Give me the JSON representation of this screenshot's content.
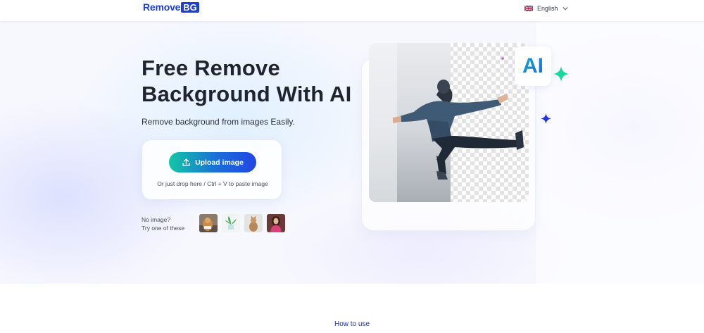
{
  "header": {
    "logo_word": "Remove",
    "logo_box": "BG",
    "language": "English"
  },
  "hero": {
    "headline": "Free Remove Background With AI",
    "subtitle": "Remove background from images Easily.",
    "upload_label": "Upload image",
    "drop_hint": "Or just drop here / Ctrl + V to paste image",
    "no_image_line1": "No image?",
    "no_image_line2": "Try one of these",
    "samples": [
      {
        "name": "sample-image-dog",
        "icon": "dog-thumbnail"
      },
      {
        "name": "sample-image-plant",
        "icon": "plant-thumbnail"
      },
      {
        "name": "sample-image-cat",
        "icon": "cat-thumbnail"
      },
      {
        "name": "sample-image-woman",
        "icon": "woman-thumbnail"
      }
    ],
    "ai_badge": "AI"
  },
  "section": {
    "how_to_use": "How to use"
  },
  "colors": {
    "brand": "#1d3fd8",
    "button_gradient_start": "#12c7a5",
    "button_gradient_end": "#2246e6",
    "spark_green": "#16d9a0",
    "spark_blue": "#2236e0",
    "spark_purple": "#c54be0"
  }
}
